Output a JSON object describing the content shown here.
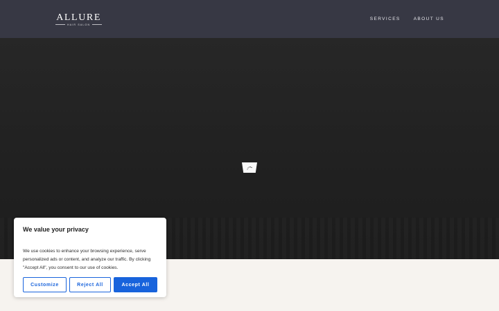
{
  "brand": {
    "name": "ALLURE",
    "tagline": "HAIR SALON"
  },
  "nav": {
    "items": [
      {
        "label": "SERVICES"
      },
      {
        "label": "ABOUT US"
      }
    ]
  },
  "hero": {
    "loader_icon": "loading-spinner-icon"
  },
  "cookie_banner": {
    "title": "We value your privacy",
    "text": "We use cookies to enhance your browsing experience, serve personalized ads or content, and analyze our traffic. By clicking \"Accept All\", you consent to our use of cookies.",
    "customize_label": "Customize",
    "reject_label": "Reject All",
    "accept_label": "Accept All"
  },
  "colors": {
    "header_bg": "#373844",
    "hero_bg": "#212121",
    "page_bg": "#f6f3ef",
    "accent": "#1863dc"
  }
}
